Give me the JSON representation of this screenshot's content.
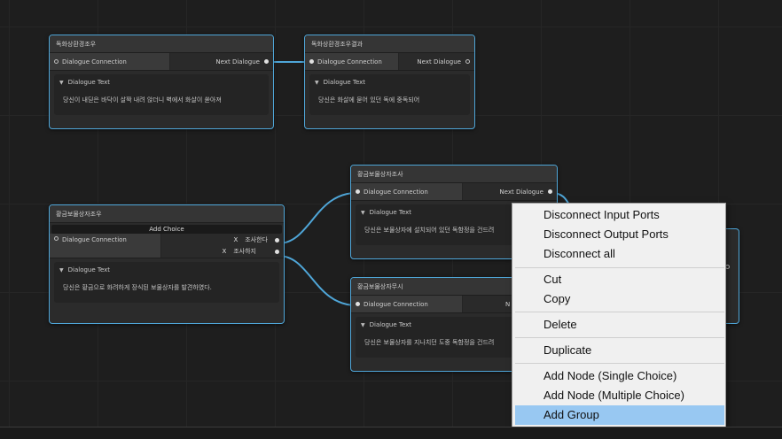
{
  "nodes": {
    "n1": {
      "title": "독화상환경조우",
      "port_in": "Dialogue Connection",
      "port_out": "Next Dialogue",
      "fold_label": "Dialogue Text",
      "text": "당신이 내딛은 바닥이 살짝 내려 앉더니 벽에서 화살이 쏟아져"
    },
    "n2": {
      "title": "독화상환경조우결과",
      "port_in": "Dialogue Connection",
      "port_out": "Next Dialogue",
      "fold_label": "Dialogue Text",
      "text": "당신은 화살에 묻어 있던 독에 중독되어"
    },
    "n3": {
      "title": "황금보물상자조우",
      "add_choice": "Add Choice",
      "port_in": "Dialogue Connection",
      "choices": [
        "조사한다",
        "조사하지"
      ],
      "delete_symbol": "X",
      "fold_label": "Dialogue Text",
      "text": "당신은 황금으로 화려하게 장식된 보물상자를 발견하였다."
    },
    "n4": {
      "title": "황금보물상자조사",
      "port_in": "Dialogue Connection",
      "port_out": "Next Dialogue",
      "fold_label": "Dialogue Text",
      "text": "당신은 보물상자에 설치되어 있던 독함정을 건드려"
    },
    "n5": {
      "title": "황금보물상자무시",
      "port_in": "Dialogue Connection",
      "port_out": "N",
      "fold_label": "Dialogue Text",
      "text": "당신은 보물상자를 지나치던 도중 독함정을 건드려"
    }
  },
  "context_menu": {
    "items": [
      "Disconnect Input Ports",
      "Disconnect Output Ports",
      "Disconnect all",
      "Cut",
      "Copy",
      "Delete",
      "Duplicate",
      "Add Node (Single Choice)",
      "Add Node (Multiple Choice)",
      "Add Group"
    ],
    "selected": "Add Group"
  },
  "colors": {
    "node_border": "#4fa6d8",
    "edge": "#4fa6d8",
    "menu_highlight": "#98c8f2",
    "canvas_bg": "#1e1e1e"
  },
  "icons": {
    "fold": "triangle-down-icon",
    "port": "port-circle-icon"
  }
}
